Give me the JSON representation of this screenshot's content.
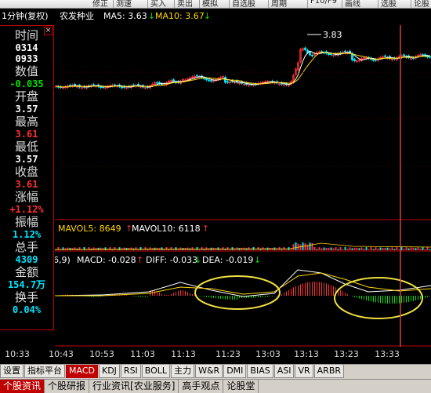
{
  "toolbar": {
    "items": [
      "修正",
      "测速",
      "买入",
      "卖出",
      "模拟",
      "自选股",
      "周期",
      "F10/F9",
      "画线",
      "选股",
      "论股"
    ]
  },
  "titlebar": {
    "period": "1分钟(复权)",
    "stock_name": "农发种业",
    "ma5_label": "MA5: 3.63",
    "ma5_arrow": "↓",
    "ma10_label": "MA10: 3.67",
    "ma10_arrow": "↓"
  },
  "info_panel": {
    "close_glyph": "×",
    "fields": [
      {
        "label": "时间",
        "values": [
          "0314",
          "0933"
        ],
        "color": "white"
      },
      {
        "label": "数值",
        "values": [
          "-0.035"
        ],
        "color": "green"
      },
      {
        "label": "开盘",
        "values": [
          "3.57"
        ],
        "color": "white"
      },
      {
        "label": "最高",
        "values": [
          "3.61"
        ],
        "color": "red"
      },
      {
        "label": "最低",
        "values": [
          "3.57"
        ],
        "color": "white"
      },
      {
        "label": "收盘",
        "values": [
          "3.61"
        ],
        "color": "red"
      },
      {
        "label": "涨幅",
        "values": [
          "+1.12%"
        ],
        "color": "red"
      },
      {
        "label": "振幅",
        "values": [
          "1.12%"
        ],
        "color": "cyan"
      },
      {
        "label": "总手",
        "values": [
          "4309"
        ],
        "color": "cyan"
      },
      {
        "label": "金额",
        "values": [
          "154.7万"
        ],
        "color": "cyan"
      },
      {
        "label": "换手",
        "values": [
          "0.04%"
        ],
        "color": "cyan"
      }
    ]
  },
  "volume_legend": {
    "mavol5": "MAVOL5: 8649",
    "mavol5_arrow": "↑",
    "mavol10": "MAVOL10: 6118",
    "mavol10_arrow": "↑"
  },
  "macd_legend": {
    "params": "6,9)",
    "macd": "MACD: -0.028",
    "macd_arrow": "↑",
    "diff": "DIFF: -0.033",
    "diff_arrow": "↓",
    "dea": "DEA: -0.019",
    "dea_arrow": "↓"
  },
  "price_annotation": "3.83",
  "time_axis": [
    "10:33",
    "10:43",
    "10:53",
    "11:03",
    "11:13",
    "11:23",
    "13:03",
    "13:13",
    "13:23",
    "13:33"
  ],
  "indicator_tabs": [
    "设置",
    "指标平台",
    "MACD",
    "KDJ",
    "RSI",
    "BOLL",
    "主力",
    "W&R",
    "DMI",
    "BIAS",
    "ASI",
    "VR",
    "ARBR"
  ],
  "indicator_tabs_active": "MACD",
  "info_tabs": [
    "个股资讯",
    "个股研报",
    "行业资讯[农业服务]",
    "高手观点",
    "论股堂"
  ],
  "info_tabs_active": "个股资讯",
  "colors": {
    "up": "#ff3030",
    "down": "#00e5ff",
    "ma5": "#ffffff",
    "ma10": "#ffd700",
    "panel_border": "#c00000",
    "highlight_circle": "#f0e040",
    "cursor_line": "#d04040"
  }
}
